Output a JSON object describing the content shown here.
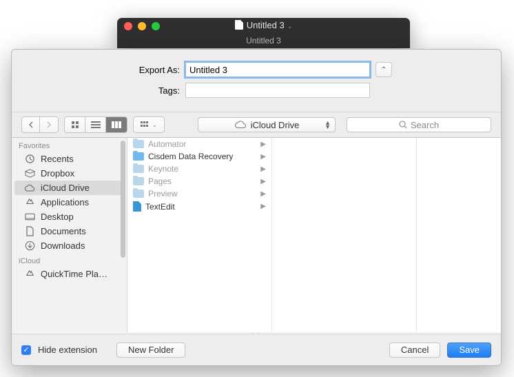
{
  "window": {
    "doc_title": "Untitled 3",
    "subtitle": "Untitled 3"
  },
  "form": {
    "export_as_label": "Export As:",
    "export_as_value": "Untitled 3",
    "tags_label": "Tags:",
    "tags_value": ""
  },
  "toolbar": {
    "location": "iCloud Drive",
    "search_placeholder": "Search"
  },
  "sidebar": {
    "section_favorites": "Favorites",
    "section_icloud": "iCloud",
    "items": [
      {
        "label": "Recents",
        "icon": "clock-icon"
      },
      {
        "label": "Dropbox",
        "icon": "box-icon"
      },
      {
        "label": "iCloud Drive",
        "icon": "cloud-icon",
        "selected": true
      },
      {
        "label": "Applications",
        "icon": "apps-icon"
      },
      {
        "label": "Desktop",
        "icon": "desktop-icon"
      },
      {
        "label": "Documents",
        "icon": "doc-icon"
      },
      {
        "label": "Downloads",
        "icon": "download-icon"
      }
    ],
    "icloud_items": [
      {
        "label": "QuickTime Pla…",
        "icon": "apps-icon"
      }
    ]
  },
  "column1": [
    {
      "label": "Automator",
      "dim": true,
      "type": "folder"
    },
    {
      "label": "Cisdem Data Recovery",
      "dim": false,
      "type": "folder"
    },
    {
      "label": "Keynote",
      "dim": true,
      "type": "folder"
    },
    {
      "label": "Pages",
      "dim": true,
      "type": "folder"
    },
    {
      "label": "Preview",
      "dim": true,
      "type": "folder"
    },
    {
      "label": "TextEdit",
      "dim": false,
      "type": "doc"
    }
  ],
  "footer": {
    "hide_ext_label": "Hide extension",
    "hide_ext_checked": true,
    "new_folder": "New Folder",
    "cancel": "Cancel",
    "save": "Save"
  }
}
